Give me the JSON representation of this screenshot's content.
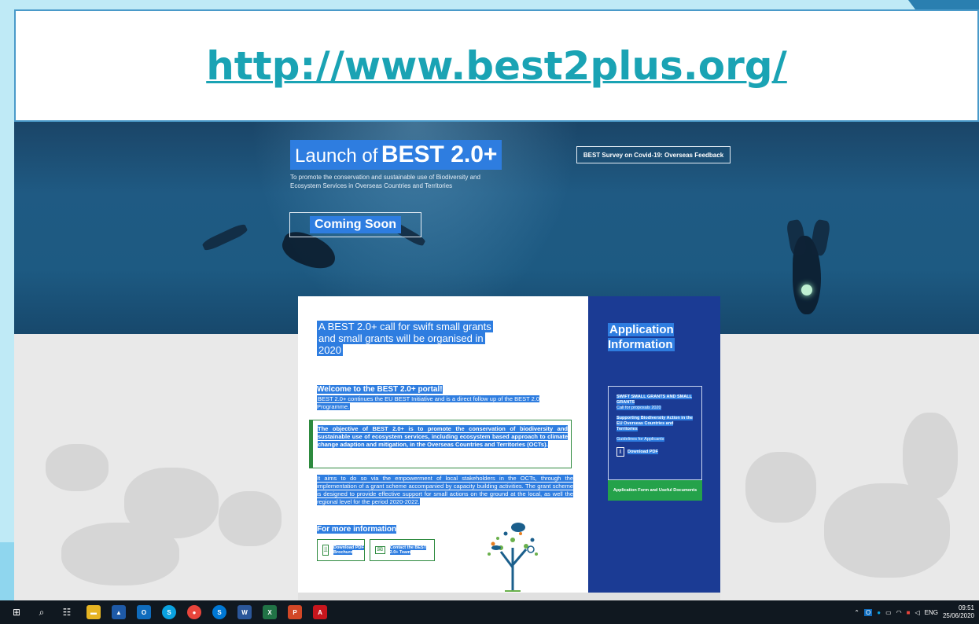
{
  "banner": {
    "url": "http://www.best2plus.org/"
  },
  "hero": {
    "launch_prefix": "Launch of",
    "launch_strong": "BEST 2.0+",
    "subtitle": "To promote the conservation and sustainable use of Biodiversity and Ecosystem Services in Overseas Countries and Territories",
    "coming_soon": "Coming Soon",
    "survey_button": "BEST Survey on Covid-19: Overseas Feedback"
  },
  "content": {
    "call_title": "A BEST 2.0+ call for swift small grants and small grants will be organised in 2020",
    "welcome_title": "Welcome to the BEST 2.0+ portal!",
    "welcome_text": "BEST 2.0+ continues the EU BEST Initiative and is a direct follow up of the BEST 2.0 Programme.",
    "objective": "The objective of BEST 2.0+ is to promote the conservation of biodiversity and sustainable use of ecosystem services, including ecosystem based approach to climate change adaption and mitigation, in the Overseas Countries and Territories (OCTs).",
    "aims": "It aims to do so via the empowerment of local stakeholders in the OCTs, through the implementation of a grant scheme accompanied by capacity building activities. The grant scheme is designed to provide effective support for small actions on the ground at the local, as well the regional level for the period 2020-2022.",
    "more_info_title": "For more information",
    "download_brochure": "Download PDF Brochure",
    "contact_team": "Contact the BEST 2.0+ Team"
  },
  "sidebar": {
    "title": "Application Information",
    "grants_title": "SWIFT SMALL GRANTS AND SMALL GRANTS",
    "call_year": "Call for proposals 2020",
    "supporting": "Supporting Biodiversity Action in the EU Overseas Countries and Territories",
    "guidelines": "Guidelines for Applicants",
    "download_pdf": "Download PDF",
    "application_form": "Application Form and Useful Documents"
  },
  "taskbar": {
    "time": "09:51",
    "date": "25/06/2020",
    "lang": "ENG",
    "apps": [
      "Outlook",
      "Skype",
      "Chrome",
      "Skype for Business",
      "Word",
      "Excel",
      "PowerPoint",
      "Acrobat"
    ]
  },
  "colors": {
    "highlight": "#2e7de0",
    "accent_green": "#2d8a3e",
    "sidebar_blue": "#1b3b94",
    "url_teal": "#1aa3b4"
  }
}
